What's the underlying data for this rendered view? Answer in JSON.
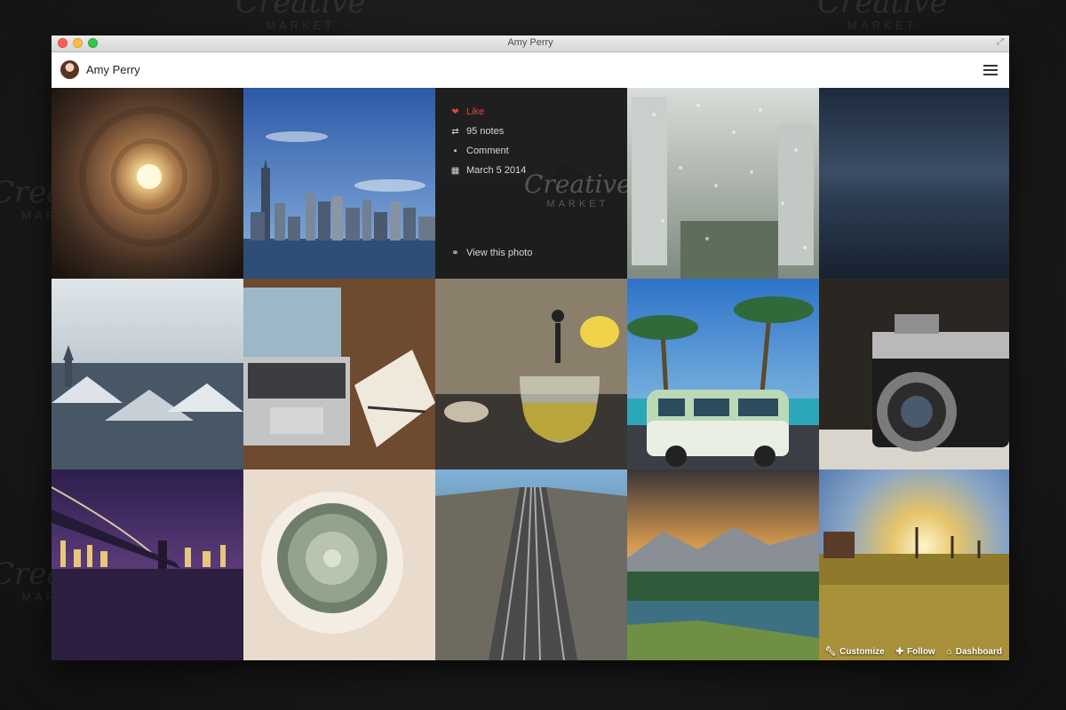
{
  "watermark": {
    "brand": "Creative",
    "sub": "MARKET"
  },
  "window": {
    "title": "Amy Perry"
  },
  "header": {
    "user_name": "Amy Perry"
  },
  "overlay": {
    "like": "Like",
    "notes": "95 notes",
    "comment": "Comment",
    "date": "March 5 2014",
    "view": "View this photo"
  },
  "footer_actions": {
    "customize": "Customize",
    "follow": "Follow",
    "dashboard": "Dashboard"
  },
  "photos": [
    "tunnel-light-photo",
    "city-skyline-photo",
    "hovered-sea-photo",
    "rain-window-photo",
    "misty-sea-photo",
    "snowy-rooftops-photo",
    "laptop-desk-photo",
    "teapot-photo",
    "palm-van-photo",
    "vintage-camera-photo",
    "bridge-night-photo",
    "cactus-photo",
    "railway-tracks-photo",
    "mountain-lake-photo",
    "sunset-field-photo"
  ],
  "colors": {
    "like": "#e0453b",
    "accent_close": "#fc605c",
    "accent_min": "#fdbc40",
    "accent_max": "#34c84a"
  }
}
